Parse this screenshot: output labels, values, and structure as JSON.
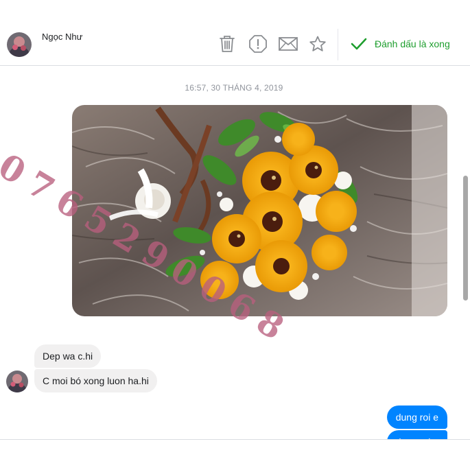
{
  "contact": {
    "name": "Ngọc Như"
  },
  "header": {
    "actions": {
      "delete": "trash-icon",
      "report": "alert-icon",
      "mail": "envelope-icon",
      "star": "star-icon"
    },
    "done_label": "Đánh dấu là xong"
  },
  "conversation": {
    "timestamp": "16:57, 30 THÁNG 4, 2019",
    "incoming": [
      {
        "text": "Dep wa c.hi"
      },
      {
        "text": "C moi bó xong luon ha.hi"
      }
    ],
    "outgoing": [
      {
        "text": "dung roi e"
      },
      {
        "text": "dung roi e"
      }
    ]
  },
  "watermark": {
    "text": "0765290068"
  },
  "colors": {
    "accent_blue": "#0084ff",
    "done_green": "#1e9e2e",
    "incoming_bubble": "#f1f0f0",
    "watermark": "#b95f7d"
  }
}
